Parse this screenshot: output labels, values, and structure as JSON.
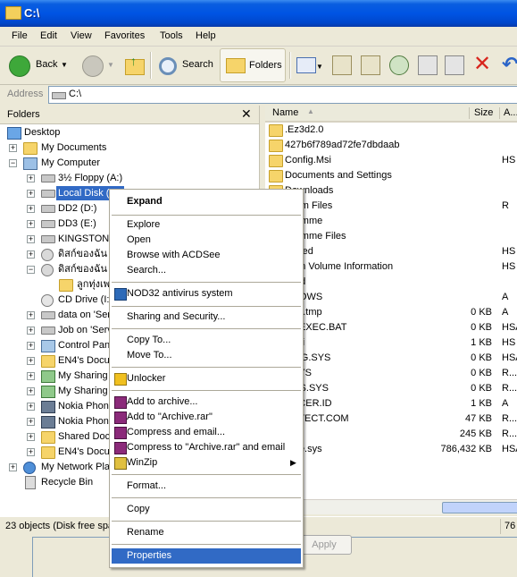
{
  "window": {
    "title": "C:\\"
  },
  "menu": [
    "File",
    "Edit",
    "View",
    "Favorites",
    "Tools",
    "Help"
  ],
  "toolbar": {
    "back": "Back",
    "search": "Search",
    "folders": "Folders"
  },
  "address": {
    "label": "Address",
    "value": "C:\\"
  },
  "folders_pane": {
    "title": "Folders",
    "tree": [
      "Desktop",
      "My Documents",
      "My Computer",
      "3½ Floppy (A:)",
      "Local Disk (C:)",
      "DD2 (D:)",
      "DD3 (E:)",
      "KINGSTON (",
      "ดิสก์ของฉัน",
      "ดิสก์ของฉัน",
      "ลูกทุ่งเพ",
      "CD Drive (I:",
      "data on 'Ser",
      "Job on 'Serv",
      "Control Pan",
      "EN4's Docu",
      "My Sharing",
      "My Sharing",
      "Nokia Phone",
      "Nokia Phone",
      "Shared Doc",
      "EN4's Docu",
      "My Network Plac",
      "Recycle Bin"
    ]
  },
  "file_list": {
    "columns": {
      "name": "Name",
      "size": "Size",
      "attr": "A..."
    },
    "rows": [
      {
        "name": ".Ez3d2.0",
        "size": "",
        "attr": ""
      },
      {
        "name": "427b6f789ad72fe7dbdaab",
        "size": "",
        "attr": ""
      },
      {
        "name": "Config.Msi",
        "size": "",
        "attr": "HS"
      },
      {
        "name": "Documents and Settings",
        "size": "",
        "attr": ""
      },
      {
        "name": "Downloads",
        "size": "",
        "attr": ""
      },
      {
        "name": "ram Files",
        "size": "",
        "attr": "R"
      },
      {
        "name": "ramme",
        "size": "",
        "attr": ""
      },
      {
        "name": "ramme Files",
        "size": "",
        "attr": ""
      },
      {
        "name": "rcled",
        "size": "",
        "attr": "HS"
      },
      {
        "name": "em Volume Information",
        "size": "",
        "attr": "HS"
      },
      {
        "name": "md",
        "size": "",
        "attr": ""
      },
      {
        "name": "DOWS",
        "size": "",
        "attr": "A"
      },
      {
        "name": "16.tmp",
        "size": "0 KB",
        "attr": "A"
      },
      {
        "name": "DEXEC.BAT",
        "size": "0 KB",
        "attr": "HSA"
      },
      {
        "name": ".ini",
        "size": "1 KB",
        "attr": "HS"
      },
      {
        "name": "FIG.SYS",
        "size": "0 KB",
        "attr": "HSA"
      },
      {
        "name": "SYS",
        "size": "0 KB",
        "attr": "R..."
      },
      {
        "name": "OS.SYS",
        "size": "0 KB",
        "attr": "R..."
      },
      {
        "name": "ACER.ID",
        "size": "1 KB",
        "attr": "A"
      },
      {
        "name": "ETECT.COM",
        "size": "47 KB",
        "attr": "R..."
      },
      {
        "name": "",
        "size": "245 KB",
        "attr": "R..."
      },
      {
        "name": "file.sys",
        "size": "786,432 KB",
        "attr": "HSA"
      }
    ]
  },
  "status": {
    "text": "23 objects (Disk free spa",
    "right": "76"
  },
  "dialog": {
    "apply": "Apply"
  },
  "context_menu": {
    "expand": "Expand",
    "explore": "Explore",
    "open": "Open",
    "browse": "Browse with ACDSee",
    "search": "Search...",
    "nod32": "NOD32 antivirus system",
    "sharing": "Sharing and Security...",
    "copy_to": "Copy To...",
    "move_to": "Move To...",
    "unlocker": "Unlocker",
    "add_archive": "Add to archive...",
    "add_rar": "Add to \"Archive.rar\"",
    "compress_email": "Compress and email...",
    "compress_rar_email": "Compress to \"Archive.rar\" and email",
    "winzip": "WinZip",
    "format": "Format...",
    "copy": "Copy",
    "rename": "Rename",
    "properties": "Properties"
  }
}
